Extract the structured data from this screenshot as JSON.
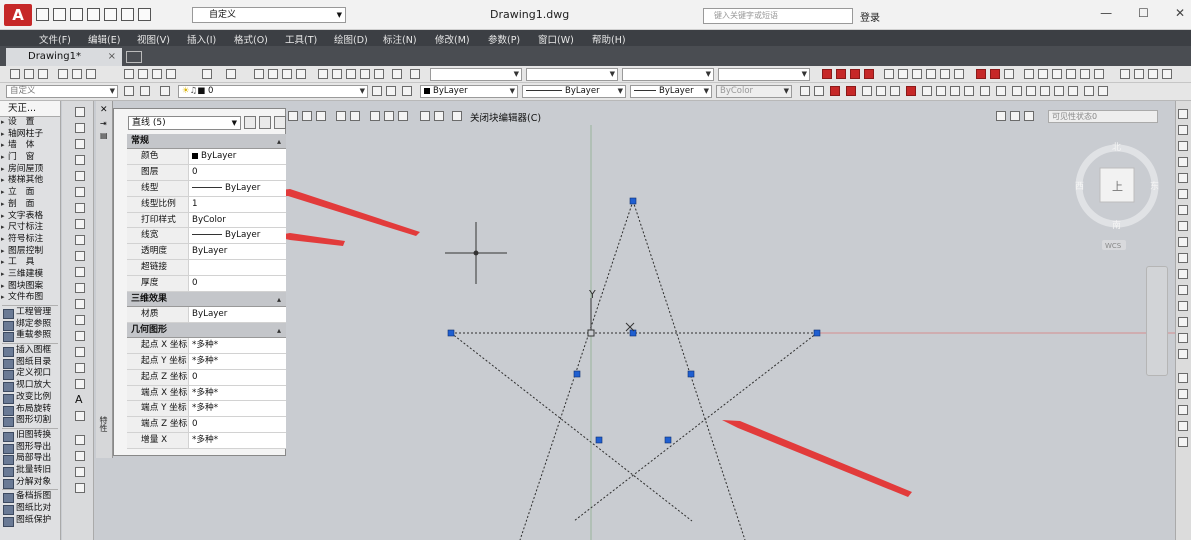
{
  "title_bar": {
    "workspace": "自定义",
    "doc_title": "Drawing1.dwg",
    "search_placeholder": "键入关键字或短语",
    "login": "登录"
  },
  "menu": [
    "文件(F)",
    "编辑(E)",
    "视图(V)",
    "插入(I)",
    "格式(O)",
    "工具(T)",
    "绘图(D)",
    "标注(N)",
    "修改(M)",
    "参数(P)",
    "窗口(W)",
    "帮助(H)"
  ],
  "tab": {
    "label": "Drawing1*",
    "close": "×"
  },
  "toolbar2": {
    "layer_value": "0",
    "color_value": "ByLayer",
    "linetype_value": "ByLayer",
    "lineweight_value": "ByLayer",
    "plotstyle_value": "ByColor",
    "ucs_name": "自定义"
  },
  "tool_palette": {
    "header": "天正...",
    "items": [
      "设　置",
      "轴网柱子",
      "墙　体",
      "门　窗",
      "房间屋顶",
      "楼梯其他",
      "立　面",
      "剖　面",
      "文字表格",
      "尺寸标注",
      "符号标注",
      "图层控制",
      "工　具",
      "三维建模",
      "图块图案",
      "文件布图"
    ],
    "items2": [
      "工程管理",
      "绑定参照",
      "重载参照",
      "插入图框",
      "图纸目录",
      "定义视口",
      "视口放大",
      "改变比例",
      "布局旋转",
      "图形切割",
      "旧图转换",
      "图形导出",
      "局部导出",
      "批量转旧",
      "分解对象",
      "备档拆图",
      "图纸比对",
      "图纸保护"
    ]
  },
  "properties": {
    "selection": "直线 (5)",
    "vertical_title": "特性",
    "sections": [
      {
        "name": "常规",
        "rows": [
          {
            "k": "颜色",
            "v": "ByLayer",
            "swatch": "#000000"
          },
          {
            "k": "图层",
            "v": "0"
          },
          {
            "k": "线型",
            "v": "ByLayer",
            "line": true
          },
          {
            "k": "线型比例",
            "v": "1"
          },
          {
            "k": "打印样式",
            "v": "ByColor"
          },
          {
            "k": "线宽",
            "v": "ByLayer",
            "line": true
          },
          {
            "k": "透明度",
            "v": "ByLayer"
          },
          {
            "k": "超链接",
            "v": ""
          },
          {
            "k": "厚度",
            "v": "0"
          }
        ]
      },
      {
        "name": "三维效果",
        "rows": [
          {
            "k": "材质",
            "v": "ByLayer"
          }
        ]
      },
      {
        "name": "几何图形",
        "rows": [
          {
            "k": "起点 X 坐标",
            "v": "*多种*"
          },
          {
            "k": "起点 Y 坐标",
            "v": "*多种*"
          },
          {
            "k": "起点 Z 坐标",
            "v": "0"
          },
          {
            "k": "端点 X 坐标",
            "v": "*多种*"
          },
          {
            "k": "端点 Y 坐标",
            "v": "*多种*"
          },
          {
            "k": "端点 Z 坐标",
            "v": "0"
          },
          {
            "k": "增量 X",
            "v": "*多种*"
          }
        ]
      }
    ]
  },
  "block_bar": {
    "close_editor": "关闭块编辑器(C)",
    "visibility_state": "可见性状态0"
  },
  "viewcube": {
    "top": "上",
    "north": "北",
    "south": "南",
    "west": "西",
    "east": "东",
    "wcs": "WCS"
  },
  "canvas": {
    "y_axis_label": "Y",
    "accent_arrow_color": "#e23b3b",
    "grip_color": "#1f5fd1"
  }
}
